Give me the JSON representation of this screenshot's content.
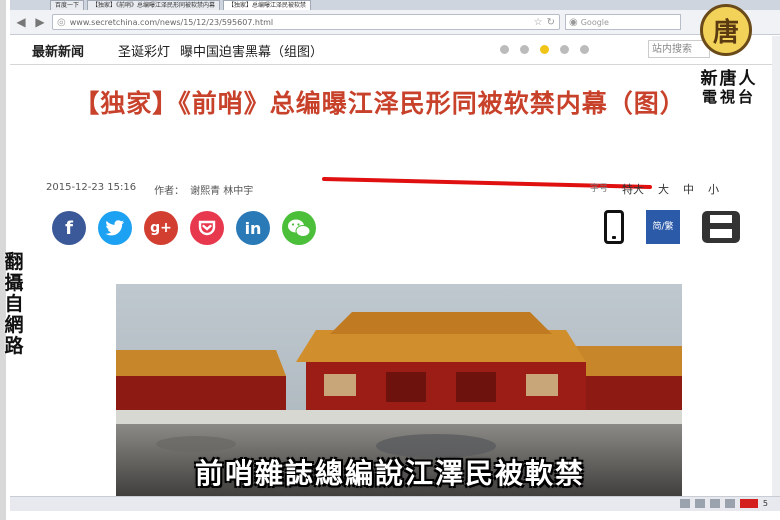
{
  "browser": {
    "tabs": [
      "百度一下",
      "【独家】《前哨》总编曝江泽民形同被软禁内幕",
      "【独家】总编曝江泽民被软禁"
    ],
    "url": "www.secretchina.com/news/15/12/23/595607.html",
    "search_placeholder": "Google"
  },
  "site": {
    "latest_news": "最新新闻",
    "ticker": [
      "圣诞彩灯",
      "曝中国迫害黑幕（组图）"
    ],
    "search_placeholder": "站内搜索"
  },
  "article": {
    "title": "【独家】《前哨》总编曝江泽民形同被软禁内幕（图）",
    "date": "2015-12-23 15:16",
    "author_label": "作者：",
    "author": "谢熙青 林中宇",
    "font_size_options": [
      "特大",
      "大",
      "中",
      "小"
    ],
    "trad_simp_label": "简/繁"
  },
  "share_icons": [
    "facebook-icon",
    "twitter-icon",
    "google-plus-icon",
    "pocket-icon",
    "linkedin-icon",
    "wechat-icon"
  ],
  "video_overlay": {
    "left_caption": [
      "翻",
      "攝",
      "自",
      "網",
      "路"
    ],
    "logo_char": "唐",
    "logo_line1": "新唐人",
    "logo_line2": "電視台",
    "subtitle": "前哨雜誌總編說江澤民被軟禁"
  },
  "status": {
    "page_number": "5"
  },
  "colors": {
    "title": "#c8412a",
    "facebook": "#3b5998",
    "twitter": "#1da1f2",
    "google_plus": "#d23f31",
    "pocket": "#e8384d",
    "linkedin": "#2a7ab8",
    "wechat": "#4bbf3a"
  }
}
